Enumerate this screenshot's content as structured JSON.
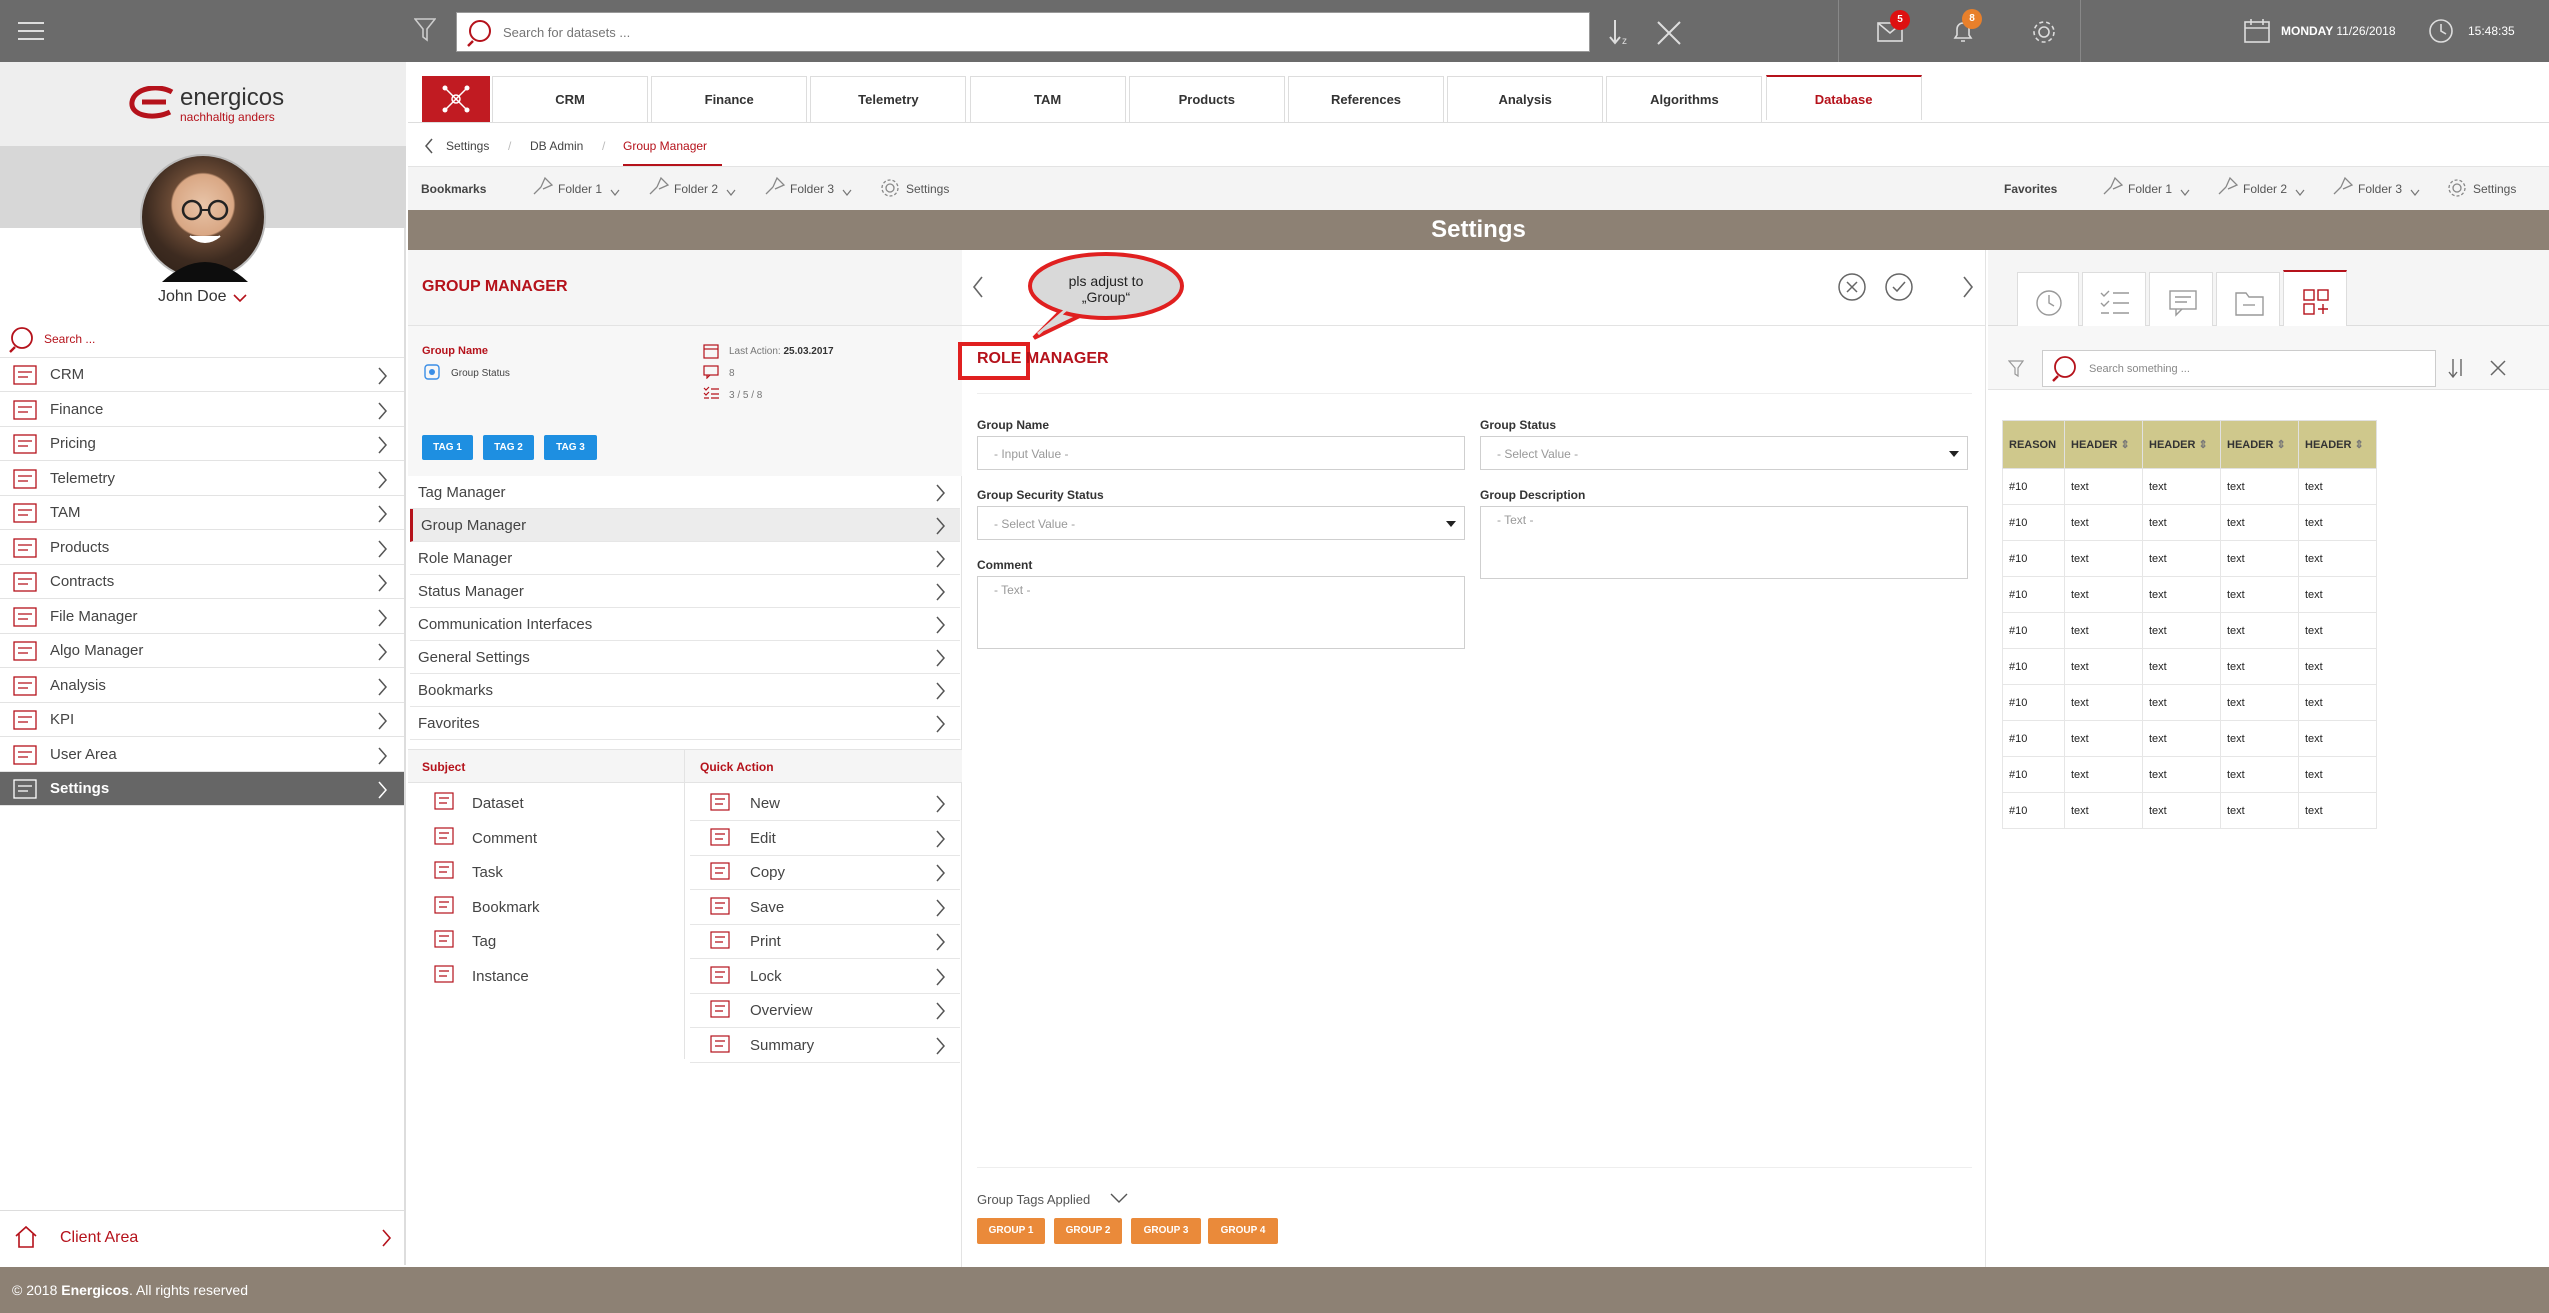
{
  "topbar": {
    "search_placeholder": "Search for datasets ...",
    "mail_count": "5",
    "bell_count": "8",
    "day": "MONDAY",
    "date": "11/26/2018",
    "time": "15:48:35"
  },
  "brand": {
    "name": "energicos",
    "tagline": "nachhaltig anders"
  },
  "user": {
    "name": "John Doe"
  },
  "sidebar": {
    "search_placeholder": "Search ...",
    "items": [
      {
        "label": "CRM",
        "icon": "crm-icon"
      },
      {
        "label": "Finance",
        "icon": "finance-icon"
      },
      {
        "label": "Pricing",
        "icon": "pricing-icon"
      },
      {
        "label": "Telemetry",
        "icon": "telemetry-icon"
      },
      {
        "label": "TAM",
        "icon": "tam-icon"
      },
      {
        "label": "Products",
        "icon": "products-icon"
      },
      {
        "label": "Contracts",
        "icon": "contracts-icon"
      },
      {
        "label": "File Manager",
        "icon": "folder-icon"
      },
      {
        "label": "Algo Manager",
        "icon": "algo-icon"
      },
      {
        "label": "Analysis",
        "icon": "analysis-icon"
      },
      {
        "label": "KPI",
        "icon": "kpi-icon"
      },
      {
        "label": "User Area",
        "icon": "eye-icon"
      },
      {
        "label": "Settings",
        "icon": "gear-icon"
      }
    ],
    "client_area": "Client Area"
  },
  "tabs": [
    "CRM",
    "Finance",
    "Telemetry",
    "TAM",
    "Products",
    "References",
    "Analysis",
    "Algorithms",
    "Database"
  ],
  "breadcrumb": [
    "Settings",
    "DB Admin",
    "Group Manager"
  ],
  "bookmarks": {
    "label": "Bookmarks",
    "items": [
      "Folder 1",
      "Folder 2",
      "Folder 3",
      "Settings"
    ],
    "favorites_label": "Favorites",
    "favorites": [
      "Folder 1",
      "Folder 2",
      "Folder 3",
      "Settings"
    ]
  },
  "page_title": "Settings",
  "group_panel": {
    "title": "GROUP MANAGER",
    "group_name_label": "Group Name",
    "group_status": "Group Status",
    "last_action_label": "Last Action:",
    "last_action_date": "25.03.2017",
    "comments_count": "8",
    "tasks": "3 / 5 / 8",
    "tags": [
      "TAG 1",
      "TAG 2",
      "TAG 3"
    ],
    "menu": [
      "Tag Manager",
      "Group Manager",
      "Role Manager",
      "Status Manager",
      "Communication Interfaces",
      "General Settings",
      "Bookmarks",
      "Favorites"
    ],
    "subject_header": "Subject",
    "quick_action_header": "Quick Action",
    "subjects": [
      "Dataset",
      "Comment",
      "Task",
      "Bookmark",
      "Tag",
      "Instance"
    ],
    "actions": [
      "New",
      "Edit",
      "Copy",
      "Save",
      "Print",
      "Lock",
      "Overview",
      "Summary"
    ]
  },
  "form": {
    "title_boxed": "ROLE",
    "title_rest": "MANAGER",
    "callout": "pls adjust to „Group“",
    "group_name_label": "Group Name",
    "group_name_placeholder": "- Input Value -",
    "group_status_label": "Group Status",
    "group_status_placeholder": "- Select Value -",
    "security_label": "Group Security Status",
    "security_placeholder": "- Select Value -",
    "description_label": "Group Description",
    "description_placeholder": "- Text -",
    "comment_label": "Comment",
    "comment_placeholder": "- Text -",
    "tags_applied_label": "Group Tags Applied",
    "group_tags": [
      "GROUP 1",
      "GROUP 2",
      "GROUP 3",
      "GROUP 4"
    ]
  },
  "right_panel": {
    "search_placeholder": "Search something ...",
    "headers": [
      "REASON",
      "HEADER",
      "HEADER",
      "HEADER",
      "HEADER"
    ],
    "rows": [
      [
        "#10",
        "text",
        "text",
        "text",
        "text"
      ],
      [
        "#10",
        "text",
        "text",
        "text",
        "text"
      ],
      [
        "#10",
        "text",
        "text",
        "text",
        "text"
      ],
      [
        "#10",
        "text",
        "text",
        "text",
        "text"
      ],
      [
        "#10",
        "text",
        "text",
        "text",
        "text"
      ],
      [
        "#10",
        "text",
        "text",
        "text",
        "text"
      ],
      [
        "#10",
        "text",
        "text",
        "text",
        "text"
      ],
      [
        "#10",
        "text",
        "text",
        "text",
        "text"
      ],
      [
        "#10",
        "text",
        "text",
        "text",
        "text"
      ],
      [
        "#10",
        "text",
        "text",
        "text",
        "text"
      ]
    ]
  },
  "footer": {
    "copyright": "© 2018 ",
    "brand": "Energicos",
    "rights": ". All rights reserved"
  }
}
